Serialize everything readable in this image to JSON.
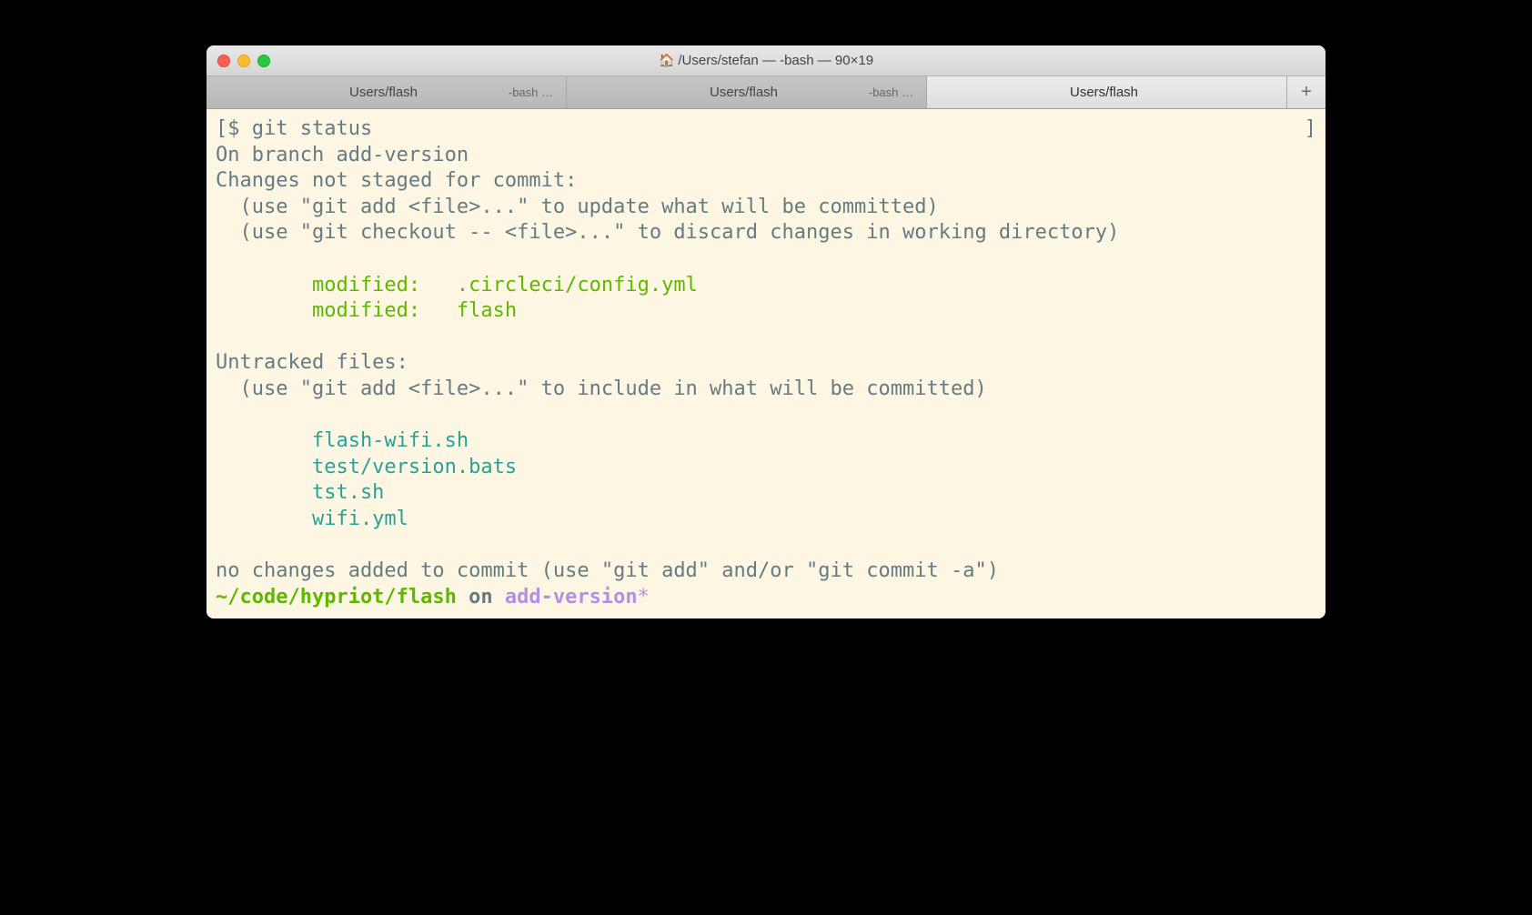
{
  "window": {
    "title": "/Users/stefan — -bash — 90×19"
  },
  "tabs": [
    {
      "title": "Users/flash",
      "subtitle": "-bash …",
      "active": false
    },
    {
      "title": "Users/flash",
      "subtitle": "-bash …",
      "active": false
    },
    {
      "title": "Users/flash",
      "subtitle": "",
      "active": true
    }
  ],
  "terminal": {
    "bracket_open": "[",
    "bracket_close": "]",
    "prompt_sym": "$ ",
    "command": "git status",
    "branch_line": "On branch add-version",
    "not_staged_header": "Changes not staged for commit:",
    "hint_add": "  (use \"git add <file>...\" to update what will be committed)",
    "hint_checkout": "  (use \"git checkout -- <file>...\" to discard changes in working directory)",
    "modified_label1": "        modified:   ",
    "modified_file1": ".circleci/config.yml",
    "modified_label2": "        modified:   ",
    "modified_file2": "flash",
    "untracked_header": "Untracked files:",
    "hint_include": "  (use \"git add <file>...\" to include in what will be committed)",
    "untracked_file1": "        flash-wifi.sh",
    "untracked_file2": "        test/version.bats",
    "untracked_file3": "        tst.sh",
    "untracked_file4": "        wifi.yml",
    "no_changes": "no changes added to commit (use \"git add\" and/or \"git commit -a\")",
    "cwd": "~/code/hypriot/flash",
    "on": " on ",
    "branch": "add-version",
    "dirty": "*"
  }
}
